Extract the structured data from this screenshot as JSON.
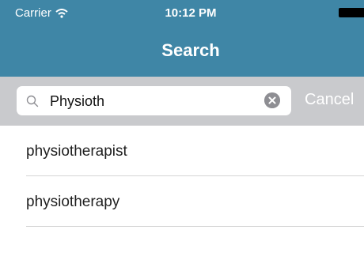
{
  "status_bar": {
    "carrier": "Carrier",
    "time": "10:12 PM",
    "icons": [
      "wifi-icon",
      "battery-icon"
    ]
  },
  "nav": {
    "title": "Search"
  },
  "search": {
    "value": "Physioth",
    "cancel_label": "Cancel",
    "icons": [
      "search-icon",
      "clear-icon"
    ]
  },
  "results": [
    {
      "label": "physiotherapist"
    },
    {
      "label": "physiotherapy"
    }
  ],
  "colors": {
    "header": "#3f86a6",
    "search_bar": "#c9cacd",
    "text": "#1f1f1f"
  }
}
